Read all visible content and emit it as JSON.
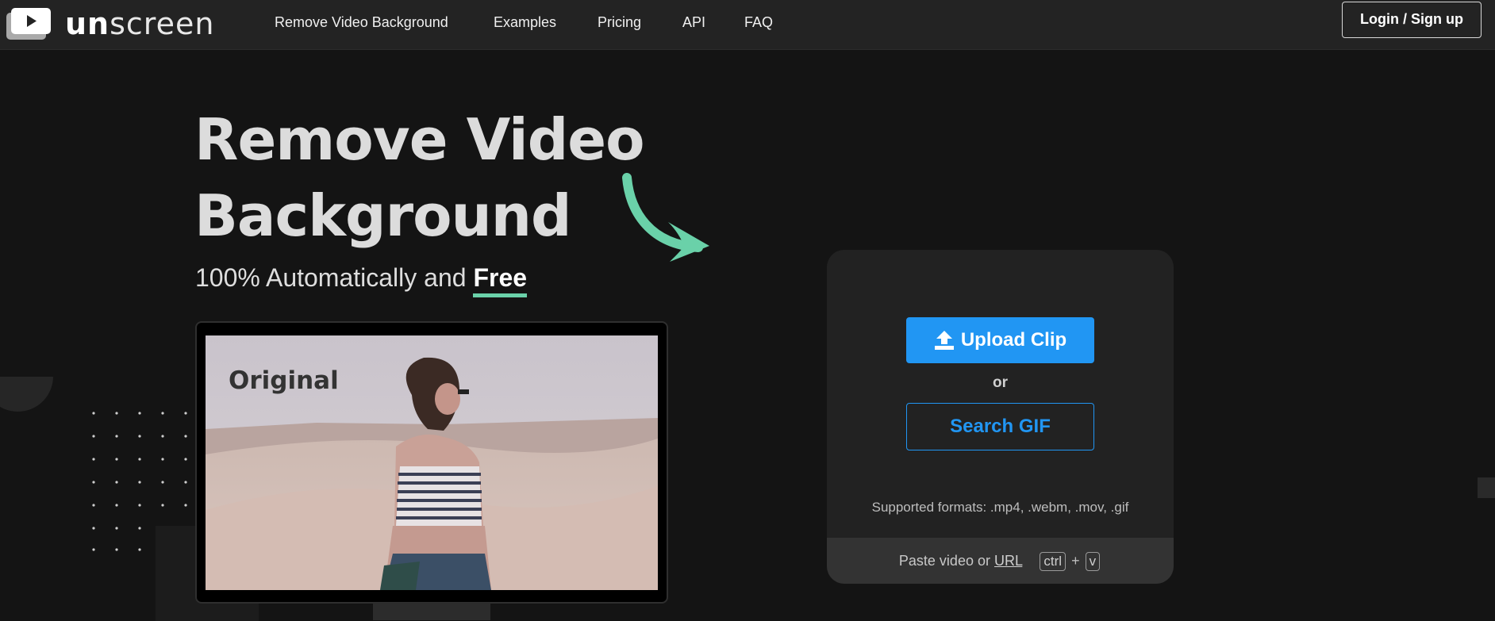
{
  "brand": {
    "logo_text_un": "un",
    "logo_text_screen": "screen",
    "accent_color": "#6ad1a9",
    "primary_color": "#2196f3"
  },
  "nav": {
    "items": [
      {
        "label": "Remove Video Background"
      },
      {
        "label": "Examples"
      },
      {
        "label": "Pricing"
      },
      {
        "label": "API"
      },
      {
        "label": "FAQ"
      }
    ],
    "login_label": "Login / Sign up"
  },
  "hero": {
    "title_line1": "Remove Video",
    "title_line2": "Background",
    "subtitle_prefix": "100% Automatically and",
    "subtitle_highlight": "Free",
    "preview_label": "Original"
  },
  "upload": {
    "upload_icon": "upload-icon",
    "upload_label": "Upload Clip",
    "or_label": "or",
    "search_label": "Search GIF",
    "formats_text": "Supported formats: .mp4, .webm, .mov, .gif",
    "paste_prefix": "Paste video or",
    "paste_url": "URL",
    "key_ctrl": "ctrl",
    "key_plus": "+",
    "key_v": "v"
  }
}
